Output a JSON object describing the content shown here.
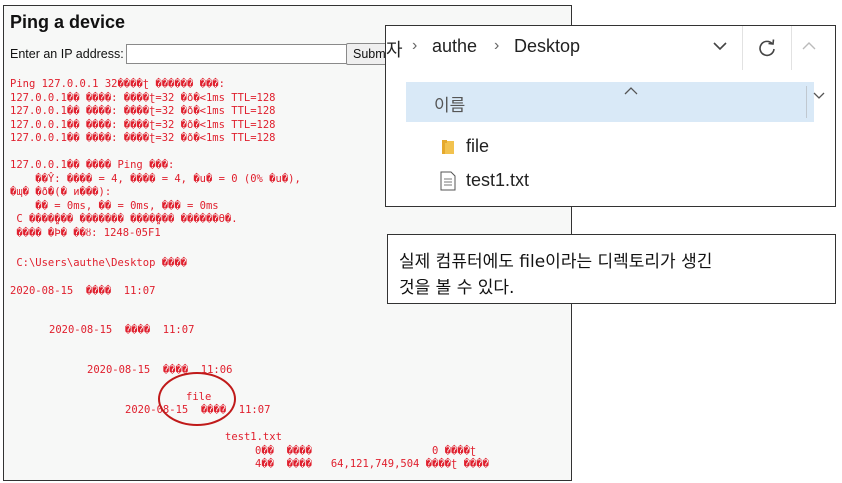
{
  "browser": {
    "title": "Ping a device",
    "ip_label": "Enter an IP address:",
    "ip_value": "",
    "submit_label": "Submit",
    "output": {
      "ping_block": "Ping 127.0.0.1 32����ʈ ������ ���:\n127.0.0.1�� ����: ����ʈ=32 �ð�<1ms TTL=128\n127.0.0.1�� ����: ����ʈ=32 �ð�<1ms TTL=128\n127.0.0.1�� ����: ����ʈ=32 �ð�<1ms TTL=128\n127.0.0.1�� ����: ����ʈ=32 �ð�<1ms TTL=128",
      "stats_block": "127.0.0.1�� ���� Ping ���:\n    ��Ŷ: ���� = 4, ���� = 4, �ս� = 0 (0% �ս�),\n�պ� �ð�(� и���):\n    �� = 0ms, �� = 0ms, ��� = 0ms\n C ����̺��� ������� ����̺��� ������ϴ�.\n ���� �Ϸ� ��ȣ: 1248-05F1",
      "dir_line": " C:\\Users\\authe\\Desktop ���͸�",
      "entry_1": "2020-08-15  ����  11:07",
      "entry_2": "2020-08-15  ����  11:07",
      "entry_3": "2020-08-15  ����  11:06",
      "file_name": "file",
      "entry_4": "2020-08-15  ����  11:07",
      "txt_name": "test1.txt",
      "summary_1": "0��  ����                   0 ����ʈ",
      "summary_2": "4��  ���͸�   64,121,749,504 ����ʈ ����"
    }
  },
  "explorer": {
    "breadcrumb_fragment": "자",
    "breadcrumb": [
      "authe",
      "Desktop"
    ],
    "column_name": "이름",
    "items": [
      {
        "name": "file",
        "type": "folder"
      },
      {
        "name": "test1.txt",
        "type": "text-file"
      }
    ],
    "icons": {
      "separator": "chevron-right-icon",
      "dropdown": "chevron-down-icon",
      "refresh": "refresh-icon",
      "folder": "folder-icon",
      "file": "text-file-icon"
    },
    "colors": {
      "header_bg": "#d9e9f7",
      "folder": "#f2c24e"
    }
  },
  "caption": {
    "line_1": "실제 컴퓨터에도 file이라는 디렉토리가 생긴",
    "line_2": "것을 볼 수 있다."
  },
  "colors": {
    "output_text": "#e0202e",
    "highlight_circle": "#c01a1a"
  }
}
